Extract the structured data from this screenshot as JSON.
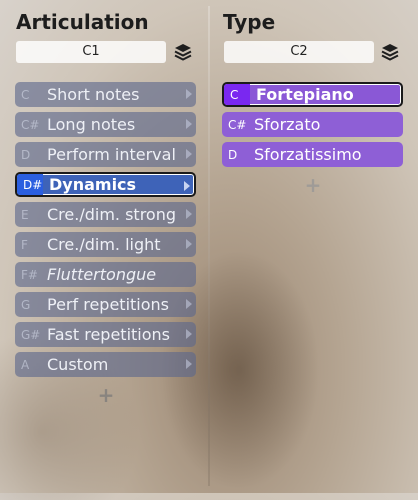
{
  "articulation": {
    "title": "Articulation",
    "key_value": "C1",
    "items": [
      {
        "key": "C",
        "label": "Short notes"
      },
      {
        "key": "C#",
        "label": "Long notes"
      },
      {
        "key": "D",
        "label": "Perform interval"
      },
      {
        "key": "D#",
        "label": "Dynamics",
        "selected": true
      },
      {
        "key": "E",
        "label": "Cre./dim. strong"
      },
      {
        "key": "F",
        "label": "Cre./dim. light"
      },
      {
        "key": "F#",
        "label": "Fluttertongue",
        "italic": true
      },
      {
        "key": "G",
        "label": "Perf repetitions"
      },
      {
        "key": "G#",
        "label": "Fast repetitions"
      },
      {
        "key": "A",
        "label": "Custom"
      }
    ],
    "add_symbol": "+"
  },
  "type": {
    "title": "Type",
    "key_value": "C2",
    "items": [
      {
        "key": "C",
        "label": "Fortepiano",
        "selected": true
      },
      {
        "key": "C#",
        "label": "Sforzato"
      },
      {
        "key": "D",
        "label": "Sforzatissimo"
      }
    ],
    "add_symbol": "+"
  },
  "icons": {
    "layers": "layers-icon",
    "submenu": "chevron-right-icon"
  },
  "colors": {
    "left_selected": "#3e63b8",
    "right_item": "#8e5fd6",
    "right_selected_key": "#7a28f0"
  }
}
